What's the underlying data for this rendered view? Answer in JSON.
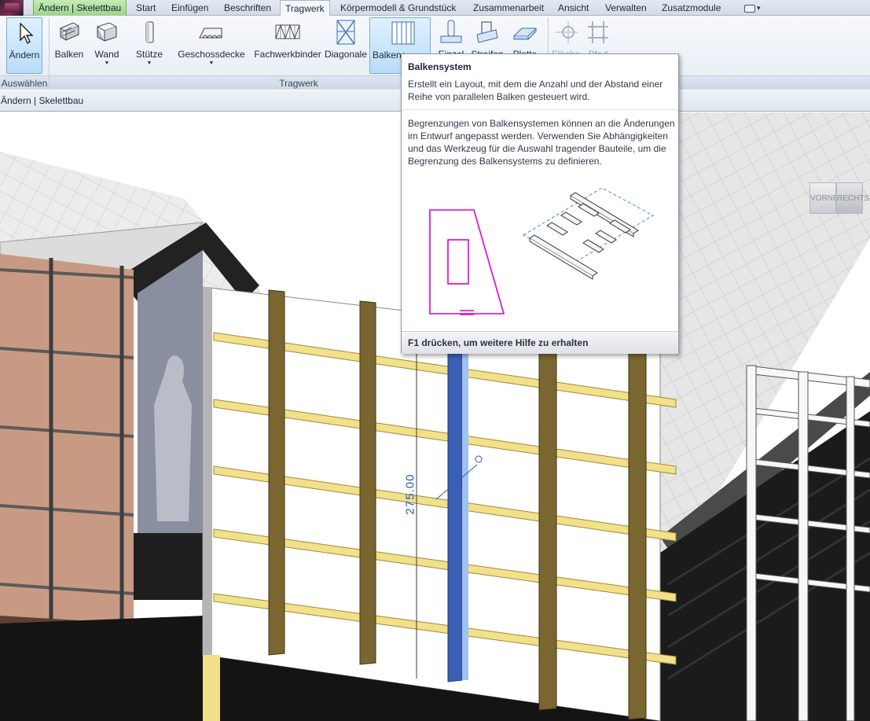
{
  "tabbar": {
    "tabs": [
      {
        "label": "Ändern | Skelettbau",
        "state": "context"
      },
      {
        "label": "Start",
        "state": "normal"
      },
      {
        "label": "Einfügen",
        "state": "normal"
      },
      {
        "label": "Beschriften",
        "state": "normal"
      },
      {
        "label": "Tragwerk",
        "state": "active"
      },
      {
        "label": "Körpermodell & Grundstück",
        "state": "normal"
      },
      {
        "label": "Zusammenarbeit",
        "state": "normal"
      },
      {
        "label": "Ansicht",
        "state": "normal"
      },
      {
        "label": "Verwalten",
        "state": "normal"
      },
      {
        "label": "Zusatzmodule",
        "state": "normal"
      }
    ],
    "extra_caret": "▾"
  },
  "ribbon": {
    "buttons": [
      {
        "label": "Ändern",
        "icon": "cursor-icon",
        "dropdown": false
      },
      {
        "label": "Balken",
        "icon": "beam-icon",
        "dropdown": false
      },
      {
        "label": "Wand",
        "icon": "wall-icon",
        "dropdown": true
      },
      {
        "label": "Stütze",
        "icon": "column-icon",
        "dropdown": true
      },
      {
        "label": "Geschossdecke",
        "icon": "floor-icon",
        "dropdown": true
      },
      {
        "label": "Fachwerkbinder",
        "icon": "truss-icon",
        "dropdown": false
      },
      {
        "label": "Diagonale",
        "icon": "brace-icon",
        "dropdown": false
      },
      {
        "label": "Balkensystem",
        "visible_label": "Balkens",
        "icon": "beam-system-icon",
        "dropdown": false
      },
      {
        "label": "Einzel",
        "icon": "isolated-foundation-icon",
        "dropdown": false
      },
      {
        "label": "Streifen",
        "icon": "wall-foundation-icon",
        "dropdown": false
      },
      {
        "label": "Platte",
        "icon": "slab-foundation-icon",
        "dropdown": false
      },
      {
        "label": "Fläche",
        "icon": "area-rebar-icon",
        "dropdown": false
      },
      {
        "label": "Pfad",
        "icon": "path-rebar-icon",
        "dropdown": false
      }
    ],
    "panels": {
      "select": "Auswählen",
      "structure": "Tragwerk"
    }
  },
  "options_bar": {
    "text": "Ändern | Skelettbau"
  },
  "view": {
    "dimension_value": "275.00",
    "viewcube": {
      "front": "VORNE",
      "right": "RECHTS"
    }
  },
  "tooltip": {
    "title": "Balkensystem",
    "description": "Erstellt ein Layout, mit dem die Anzahl und der Abstand einer Reihe von parallelen Balken gesteuert wird.",
    "detail": "Begrenzungen von Balkensystemen können an die Änderungen im Entwurf angepasst werden. Verwenden Sie Abhängigkeiten und das Werkzeug für die Auswahl tragender Bauteile, um die Begrenzung des Balkensystems zu definieren.",
    "footer": "F1 drücken, um weitere Hilfe zu erhalten"
  },
  "colors": {
    "accent": "#2a55c8",
    "context_tab": "#9ed28a",
    "column_selected": "#3a5fb4",
    "sketch_line": "#e000d0",
    "yellow_girt": "#f2e08a",
    "brown_post": "#7a6630"
  }
}
